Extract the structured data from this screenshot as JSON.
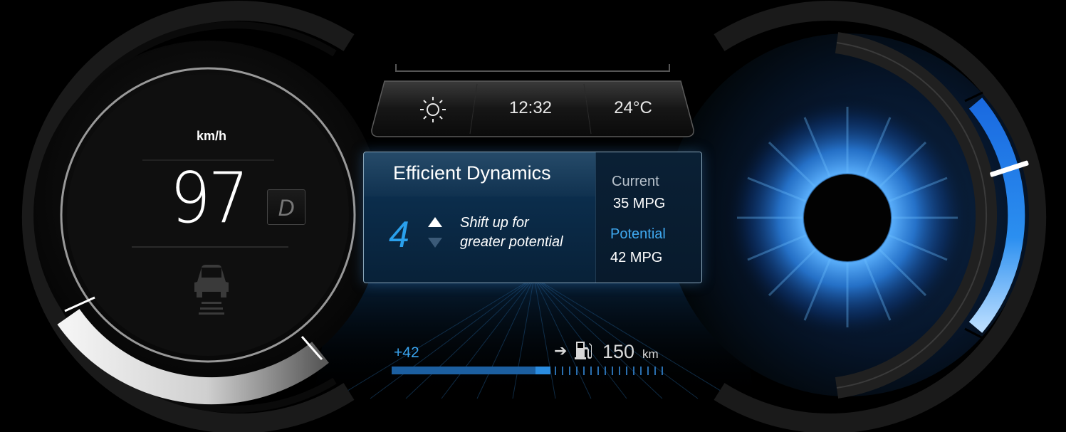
{
  "speedometer": {
    "unit": "km/h",
    "speed": "97",
    "gear": "D",
    "icon": "car-on-road-icon"
  },
  "status_bar": {
    "weather_icon": "sun-icon",
    "time": "12:32",
    "temperature": "24°C"
  },
  "efficiency_panel": {
    "title": "Efficient Dynamics",
    "recommended_gear": "4",
    "hint_line1": "Shift up for",
    "hint_line2": "greater potential",
    "current_label": "Current",
    "current_value": "35 MPG",
    "potential_label": "Potential",
    "potential_value": "42 MPG"
  },
  "range": {
    "delta": "+42",
    "arrow": "➔",
    "fuel_icon": "fuel-pump-icon",
    "distance": "150",
    "distance_unit": "km"
  },
  "colors": {
    "accent_blue": "#2aa0ec",
    "background": "#000000",
    "panel_blue": "#0d3658"
  }
}
